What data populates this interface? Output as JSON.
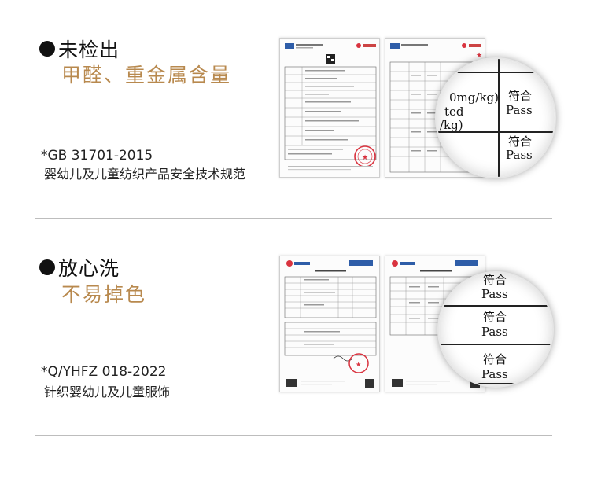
{
  "sections": [
    {
      "heading": "未检出",
      "subtitle": "甲醛、重金属含量",
      "standard_code": "*GB 31701-2015",
      "standard_name": "婴幼儿及儿童纺织产品安全技术规范",
      "magnifier": {
        "fragments": [
          "0mg/kg)",
          "ted",
          "/kg)"
        ],
        "results": [
          {
            "cn": "符合",
            "en": "Pass"
          },
          {
            "cn": "符合",
            "en": "Pass"
          }
        ]
      }
    },
    {
      "heading": "放心洗",
      "subtitle": "不易掉色",
      "standard_code": "*Q/YHFZ 018-2022",
      "standard_name": "针织婴幼儿及儿童服饰",
      "magnifier": {
        "results": [
          {
            "cn": "符合",
            "en": "Pass"
          },
          {
            "cn": "符合",
            "en": "Pass"
          },
          {
            "cn": "符合",
            "en": "Pass"
          }
        ]
      }
    }
  ],
  "colors": {
    "accent": "#b8894e",
    "seal": "#d9333f",
    "divider": "#bdbdbd"
  }
}
